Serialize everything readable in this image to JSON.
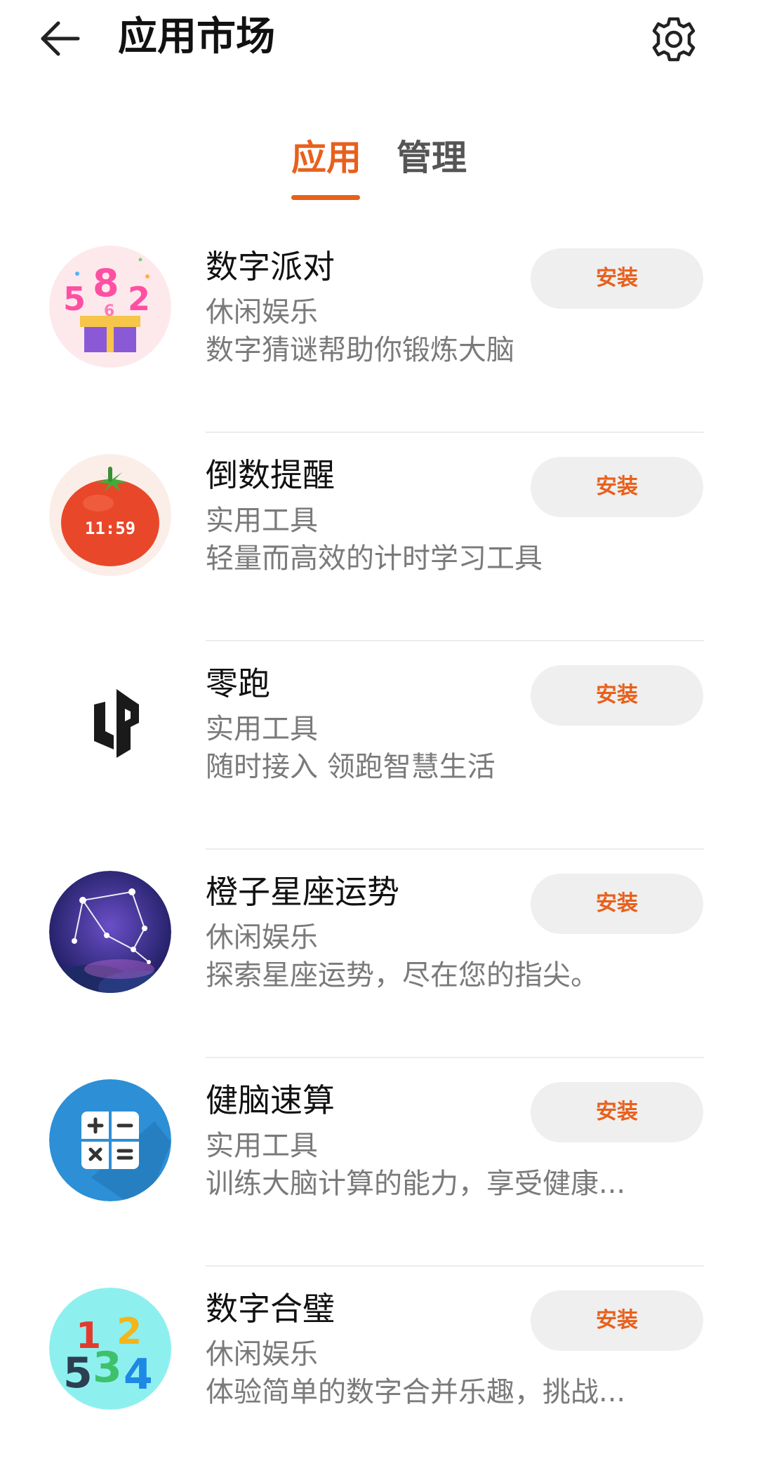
{
  "header": {
    "title": "应用市场",
    "back_icon": "back-arrow-icon",
    "settings_icon": "gear-icon"
  },
  "tabs": [
    {
      "label": "应用",
      "active": true
    },
    {
      "label": "管理",
      "active": false
    }
  ],
  "accent_color": "#E8601C",
  "apps": [
    {
      "name": "数字派对",
      "category": "休闲娱乐",
      "description": "数字猜谜帮助你锻炼大脑",
      "action": "安装",
      "icon": "number-party-icon"
    },
    {
      "name": "倒数提醒",
      "category": "实用工具",
      "description": "轻量而高效的计时学习工具",
      "action": "安装",
      "icon": "tomato-timer-icon",
      "icon_text": "11:59"
    },
    {
      "name": "零跑",
      "category": "实用工具",
      "description": "随时接入 领跑智慧生活",
      "action": "安装",
      "icon": "leapmotor-logo-icon"
    },
    {
      "name": "橙子星座运势",
      "category": "休闲娱乐",
      "description": "探索星座运势，尽在您的指尖。",
      "action": "安装",
      "icon": "constellation-icon"
    },
    {
      "name": "健脑速算",
      "category": "实用工具",
      "description": "训练大脑计算的能力，享受健康...",
      "action": "安装",
      "icon": "calculator-icon"
    },
    {
      "name": "数字合璧",
      "category": "休闲娱乐",
      "description": "体验简单的数字合并乐趣，挑战...",
      "action": "安装",
      "icon": "number-merge-icon"
    }
  ]
}
